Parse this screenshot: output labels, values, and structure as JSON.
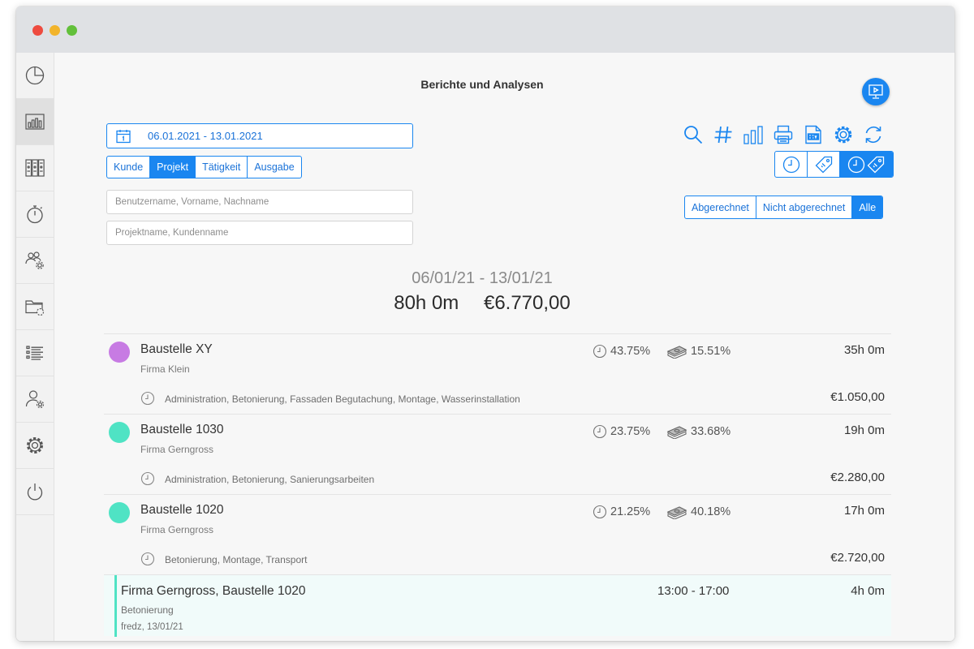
{
  "window": {
    "controls": [
      "close",
      "minimize",
      "zoom"
    ]
  },
  "sidebar": {
    "items": [
      {
        "name": "dashboard",
        "icon": "pie-chart-icon",
        "active": false
      },
      {
        "name": "reports",
        "icon": "bar-chart-icon",
        "active": true
      },
      {
        "name": "projects",
        "icon": "binders-icon",
        "active": false
      },
      {
        "name": "timer",
        "icon": "stopwatch-icon",
        "active": false
      },
      {
        "name": "team-settings",
        "icon": "users-gear-icon",
        "active": false
      },
      {
        "name": "folder-settings",
        "icon": "folder-gear-icon",
        "active": false
      },
      {
        "name": "list",
        "icon": "list-icon",
        "active": false
      },
      {
        "name": "user-settings",
        "icon": "user-gear-icon",
        "active": false
      },
      {
        "name": "settings",
        "icon": "gear-icon",
        "active": false
      },
      {
        "name": "logout",
        "icon": "power-icon",
        "active": false
      }
    ]
  },
  "header": {
    "title": "Berichte und Analysen",
    "help_icon": "presentation-play-icon"
  },
  "filters": {
    "date_range": "06.01.2021 - 13.01.2021",
    "group_by": [
      "Kunde",
      "Projekt",
      "Tätigkeit",
      "Ausgabe"
    ],
    "group_by_selected": "Projekt",
    "user_placeholder": "Benutzername, Vorname, Nachname",
    "project_placeholder": "Projektname, Kundenname",
    "billing": [
      "Abgerechnet",
      "Nicht abgerechnet",
      "Alle"
    ],
    "billing_selected": "Alle"
  },
  "toolbar": {
    "icons": [
      "search-icon",
      "hash-icon",
      "bar-chart-icon",
      "print-icon",
      "csv-file-icon",
      "gear-icon",
      "refresh-icon"
    ]
  },
  "mode_toggle": {
    "options": [
      "time",
      "money",
      "time-and-money"
    ],
    "selected": "time-and-money"
  },
  "summary": {
    "range": "06/01/21 - 13/01/21",
    "total_hours": "80h 0m",
    "total_amount": "€6.770,00"
  },
  "projects": [
    {
      "name": "Baustelle XY",
      "client": "Firma Klein",
      "color": "#c77be3",
      "time_share": "43.75%",
      "cost_share": "15.51%",
      "hours": "35h 0m",
      "activities": "Administration, Betonierung, Fassaden Begutachung, Montage, Wasserinstallation",
      "amount": "€1.050,00"
    },
    {
      "name": "Baustelle 1030",
      "client": "Firma Gerngross",
      "color": "#4fe3c4",
      "time_share": "23.75%",
      "cost_share": "33.68%",
      "hours": "19h 0m",
      "activities": "Administration, Betonierung, Sanierungsarbeiten",
      "amount": "€2.280,00"
    },
    {
      "name": "Baustelle 1020",
      "client": "Firma Gerngross",
      "color": "#4fe3c4",
      "time_share": "21.25%",
      "cost_share": "40.18%",
      "hours": "17h 0m",
      "activities": "Betonierung, Montage, Transport",
      "amount": "€2.720,00"
    }
  ],
  "entry": {
    "title": "Firma Gerngross, Baustelle 1020",
    "activity": "Betonierung",
    "meta": "fredz, 13/01/21",
    "time_range": "13:00 - 17:00",
    "duration": "4h 0m",
    "accent_color": "#4fe3c4"
  },
  "colors": {
    "accent": "#1a86f0",
    "titlebar": "#dfe1e4"
  }
}
